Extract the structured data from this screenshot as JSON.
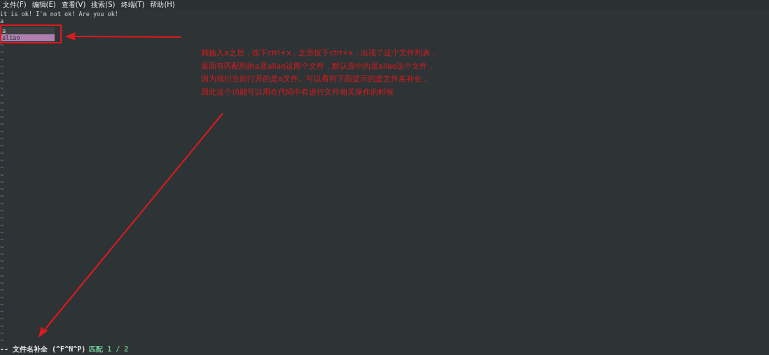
{
  "menu_bar": [
    "文件(F)",
    "编辑(E)",
    "查看(V)",
    "搜索(S)",
    "终端(T)",
    "帮助(H)"
  ],
  "buffer_lines": [
    "it is ok! I'm not ok! Are you ok!",
    "a"
  ],
  "completion_popup": [
    {
      "label": "a",
      "selected": false
    },
    {
      "label": "aliao",
      "selected": true
    }
  ],
  "empty_lines": [
    "~",
    "~",
    "~",
    "~",
    "~",
    "~",
    "~",
    "~",
    "~",
    "~",
    "~",
    "~",
    "~",
    "~",
    "~",
    "~",
    "~",
    "~",
    "~",
    "~",
    "~",
    "~",
    "~",
    "~",
    "~",
    "~",
    "~",
    "~",
    "~",
    "~",
    "~",
    "~",
    "~",
    "~",
    "~",
    "~",
    "~",
    "~",
    "~",
    "~",
    "~",
    "~"
  ],
  "status_line": {
    "mode": "-- 文件名补全 (^F^N^P)",
    "match": "匹配 1 / 2"
  },
  "annotation": [
    "我输入a之后，按下ctrl+x，之后按下ctrl+x，出现了这个文件列表，",
    "里面有匹配到的a及aliao这两个文件，默认选中的是aliao这个文件，",
    "因为我们当前打开的是a文件。可以看到下面提示的是文件名补全，",
    "因此这个功能可以用在代码中有进行文件相关操作的时候"
  ]
}
